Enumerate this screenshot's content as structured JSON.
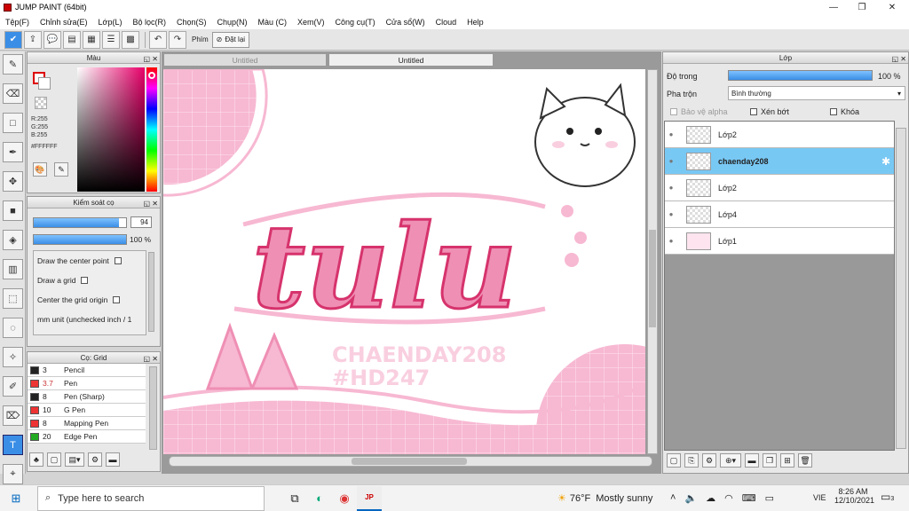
{
  "window": {
    "title": "JUMP PAINT (64bit)"
  },
  "menu": [
    "Tệp(F)",
    "Chỉnh sửa(E)",
    "Lớp(L)",
    "Bộ lọc(R)",
    "Chọn(S)",
    "Chụp(N)",
    "Màu (C)",
    "Xem(V)",
    "Công cụ(T)",
    "Cửa sổ(W)",
    "Cloud",
    "Help"
  ],
  "toolbar": {
    "phim_label": "Phím",
    "reset_label": "Đặt lại"
  },
  "color_panel": {
    "title": "Màu",
    "r": "R:255",
    "g": "G:255",
    "b": "B:255",
    "hex": "#FFFFFF"
  },
  "brush_control": {
    "title": "Kiểm soát cọ",
    "size_value": "94",
    "opacity_value": "100 %",
    "options": [
      "Draw the center point",
      "Draw a grid",
      "Center the grid origin",
      "mm unit (unchecked inch / 1"
    ]
  },
  "brush_list": {
    "title": "Cọ: Grid",
    "items": [
      {
        "size": "3",
        "name": "Pencil",
        "color": "#222222"
      },
      {
        "size": "3.7",
        "name": "Pen",
        "color": "#ee3333"
      },
      {
        "size": "8",
        "name": "Pen (Sharp)",
        "color": "#222222"
      },
      {
        "size": "10",
        "name": "G Pen",
        "color": "#ee3333"
      },
      {
        "size": "8",
        "name": "Mapping Pen",
        "color": "#ee3333"
      },
      {
        "size": "20",
        "name": "Edge Pen",
        "color": "#22aa22"
      }
    ]
  },
  "canvas": {
    "tabs": [
      "Untitled",
      "Untitled"
    ],
    "art_title": "tulu",
    "art_sub1": "CHAENDAY208",
    "art_sub2": "#HD247"
  },
  "layer_panel": {
    "title": "Lớp",
    "opacity_label": "Độ trong",
    "opacity_value": "100 %",
    "opacity_fraction": 1.0,
    "blend_label": "Pha trộn",
    "blend_value": "Bình thường",
    "protect_alpha": "Bảo vệ alpha",
    "clip": "Xén bớt",
    "lock": "Khóa",
    "layers": [
      {
        "name": "Lớp2",
        "selected": false
      },
      {
        "name": "chaenday208",
        "selected": true
      },
      {
        "name": "Lớp2",
        "selected": false
      },
      {
        "name": "Lớp4",
        "selected": false
      },
      {
        "name": "Lớp1",
        "selected": false
      }
    ]
  },
  "taskbar": {
    "search_placeholder": "Type here to search",
    "weather_temp": "76°F",
    "weather_text": "Mostly sunny",
    "lang": "VIE",
    "time": "8:26 AM",
    "date": "12/10/2021",
    "notif": "3"
  }
}
